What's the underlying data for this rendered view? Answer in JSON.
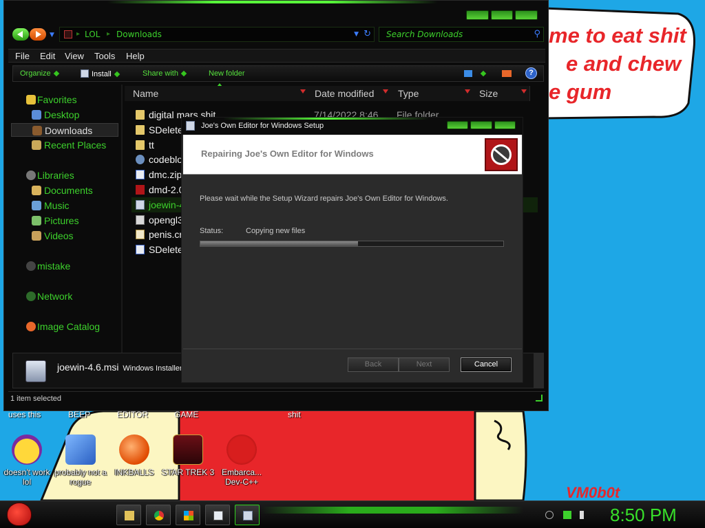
{
  "wallpaper": {
    "bubble_lines": [
      "me to eat shit",
      "e and chew",
      "e gum"
    ],
    "watermark": "VM0b0t"
  },
  "desktop_icons": {
    "top_row": [
      "uses this",
      "BEEP",
      "EDITOR",
      "GAME",
      "shit"
    ],
    "items": [
      {
        "label": "doesn't work lol",
        "icon": "yahoo-messenger-icon"
      },
      {
        "label": "probably not a rogue",
        "icon": "gears-app-icon"
      },
      {
        "label": "INKBALLS",
        "icon": "inkball-icon"
      },
      {
        "label": "STAR TREK 3",
        "icon": "star-wars-icon"
      },
      {
        "label": "Embarca... Dev-C++",
        "icon": "dev-cpp-icon"
      }
    ]
  },
  "explorer": {
    "breadcrumb": [
      "LOL",
      "Downloads"
    ],
    "search_placeholder": "Search Downloads",
    "menu": [
      "File",
      "Edit",
      "View",
      "Tools",
      "Help"
    ],
    "toolbar": {
      "organize": "Organize",
      "install": "Install",
      "share_with": "Share with",
      "new_folder": "New folder",
      "help": "?"
    },
    "nav_pane": [
      {
        "label": "Favorites",
        "level": 0,
        "icon": "star-icon"
      },
      {
        "label": "Desktop",
        "level": 1,
        "icon": "desktop-icon"
      },
      {
        "label": "Downloads",
        "level": 1,
        "icon": "downloads-icon",
        "selected": true
      },
      {
        "label": "Recent Places",
        "level": 1,
        "icon": "recent-places-icon"
      },
      {
        "label": "Libraries",
        "level": 0,
        "icon": "libraries-icon"
      },
      {
        "label": "Documents",
        "level": 1,
        "icon": "documents-icon"
      },
      {
        "label": "Music",
        "level": 1,
        "icon": "music-icon"
      },
      {
        "label": "Pictures",
        "level": 1,
        "icon": "pictures-icon"
      },
      {
        "label": "Videos",
        "level": 1,
        "icon": "videos-icon"
      },
      {
        "label": "mistake",
        "level": 0,
        "icon": "homegroup-icon"
      },
      {
        "label": "Network",
        "level": 0,
        "icon": "network-icon"
      },
      {
        "label": "Image Catalog",
        "level": 0,
        "icon": "image-catalog-icon"
      }
    ],
    "columns": [
      "Name",
      "Date modified",
      "Type",
      "Size"
    ],
    "files": [
      {
        "name": "digital mars shit",
        "date": "7/14/2022 8:46 ...",
        "type": "File folder",
        "icon": "folder-icon"
      },
      {
        "name": "SDelete",
        "date": "",
        "type": "",
        "icon": "folder-icon"
      },
      {
        "name": "tt",
        "date": "",
        "type": "",
        "icon": "folder-icon"
      },
      {
        "name": "codeblocl",
        "date": "",
        "type": "",
        "icon": "installer-icon"
      },
      {
        "name": "dmc.zip",
        "date": "",
        "type": "",
        "icon": "zip-icon"
      },
      {
        "name": "dmd-2.06",
        "date": "",
        "type": "",
        "icon": "exe-icon"
      },
      {
        "name": "joewin-4.6",
        "date": "",
        "type": "",
        "icon": "msi-icon",
        "selected": true
      },
      {
        "name": "opengl32.",
        "date": "",
        "type": "",
        "icon": "dll-icon"
      },
      {
        "name": "penis.crt",
        "date": "",
        "type": "",
        "icon": "certificate-icon"
      },
      {
        "name": "SDelete.z",
        "date": "",
        "type": "",
        "icon": "zip-icon"
      }
    ],
    "details": {
      "name": "joewin-4.6.msi",
      "type": "Windows Installer P"
    },
    "status": "1 item selected"
  },
  "setup": {
    "title": "Joe's Own Editor for Windows Setup",
    "heading": "Repairing Joe's Own Editor for Windows",
    "body": "Please wait while the Setup Wizard repairs Joe's Own Editor for Windows.",
    "status_label": "Status:",
    "status_value": "Copying new files",
    "progress": 0.52,
    "buttons": {
      "back": "Back",
      "next": "Next",
      "cancel": "Cancel"
    }
  },
  "taskbar": {
    "clock": "8:50 PM",
    "buttons": [
      "explorer-icon",
      "chrome-icon",
      "windows-logo-icon",
      "window-icon",
      "setup-icon"
    ]
  },
  "colors": {
    "accent_green": "#3dd12c",
    "wallpaper_blue": "#1ea7e6",
    "wallpaper_red": "#e8262a"
  }
}
